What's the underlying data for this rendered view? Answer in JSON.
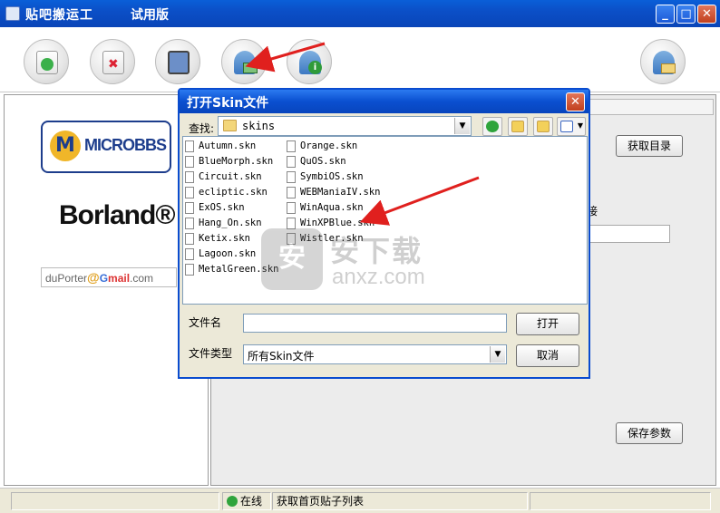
{
  "window": {
    "title": "贴吧搬运工",
    "subtitle": "试用版",
    "minimize_icon": "minimize-icon",
    "maximize_icon": "maximize-icon",
    "close_icon": "close-icon"
  },
  "toolbar": {
    "buttons": [
      {
        "name": "refresh-doc-icon"
      },
      {
        "name": "delete-doc-icon"
      },
      {
        "name": "computer-icon"
      },
      {
        "name": "user-skin-icon"
      },
      {
        "name": "user-info-icon"
      },
      {
        "name": "user-mail-icon"
      }
    ]
  },
  "left_panel": {
    "logo1_mark": "M",
    "logo1_text": "MICROBBS",
    "logo2_text": "Borland®",
    "email_prefix": "duPorter",
    "email_at": "@",
    "email_g": "G",
    "email_mail": "mail",
    "email_suffix": ".com"
  },
  "right_panel": {
    "get_dir_button": "获取目录",
    "partial_label": "接",
    "save_params_button": "保存参数"
  },
  "dialog": {
    "title": "打开Skin文件",
    "look_in_label": "查找:",
    "look_in_value": "skins",
    "files_col1": [
      "Autumn.skn",
      "BlueMorph.skn",
      "Circuit.skn",
      "ecliptic.skn",
      "ExOS.skn",
      "Hang_On.skn",
      "Ketix.skn",
      "Lagoon.skn",
      "MetalGreen.skn"
    ],
    "files_col2": [
      "Orange.skn",
      "QuOS.skn",
      "SymbiOS.skn",
      "WEBManiaIV.skn",
      "WinAqua.skn",
      "WinXPBlue.skn",
      "Wistler.skn"
    ],
    "filename_label": "文件名",
    "filename_value": "",
    "filetype_label": "文件类型",
    "filetype_value": "所有Skin文件",
    "open_button": "打开",
    "cancel_button": "取消"
  },
  "watermark": {
    "shield_text": "安",
    "cn": "安下载",
    "en": "anxz.com"
  },
  "status": {
    "online": "在线",
    "message": "获取首页贴子列表"
  },
  "colors": {
    "titlebar": "#0a4fc7",
    "arrow": "#e0201e",
    "dialog_bg": "#ece9d8"
  }
}
